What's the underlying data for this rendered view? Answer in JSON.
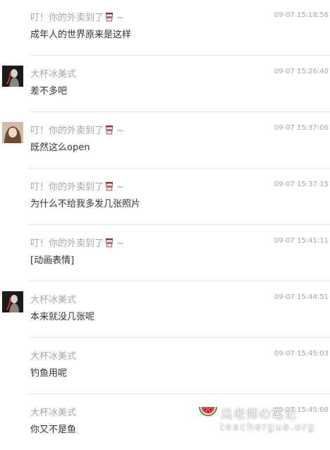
{
  "comments": [
    {
      "name": "叮！你的外卖到了",
      "emoji": true,
      "time": "09-07 15:18:56",
      "text": "成年人的世界原来是这样",
      "avatar": ""
    },
    {
      "name": "大杯冰美式",
      "emoji": false,
      "time": "09-07 15:26:40",
      "text": "差不多吧",
      "avatar": "dark"
    },
    {
      "name": "叮！你的外卖到了",
      "emoji": true,
      "time": "09-07 15:37:06",
      "text": "既然这么open",
      "avatar": "photo"
    },
    {
      "name": "叮！你的外卖到了",
      "emoji": true,
      "time": "09-07 15:37:15",
      "text": "为什么不给我多发几张照片",
      "avatar": ""
    },
    {
      "name": "叮！你的外卖到了",
      "emoji": true,
      "time": "09-07 15:41:11",
      "text": "[动画表情]",
      "avatar": ""
    },
    {
      "name": "大杯冰美式",
      "emoji": false,
      "time": "09-07 15:44:51",
      "text": "本来就没几张呢",
      "avatar": "dark"
    },
    {
      "name": "大杯冰美式",
      "emoji": false,
      "time": "09-07 15:45:03",
      "text": "钓鱼用呢",
      "avatar": ""
    },
    {
      "name": "大杯冰美式",
      "emoji": false,
      "time": "09-07 15:45:08",
      "text": "你又不是鱼",
      "avatar": ""
    }
  ],
  "emoji_tail": "~",
  "watermark": {
    "title": "瓜老师の笔记",
    "url": "teachergua.org"
  }
}
